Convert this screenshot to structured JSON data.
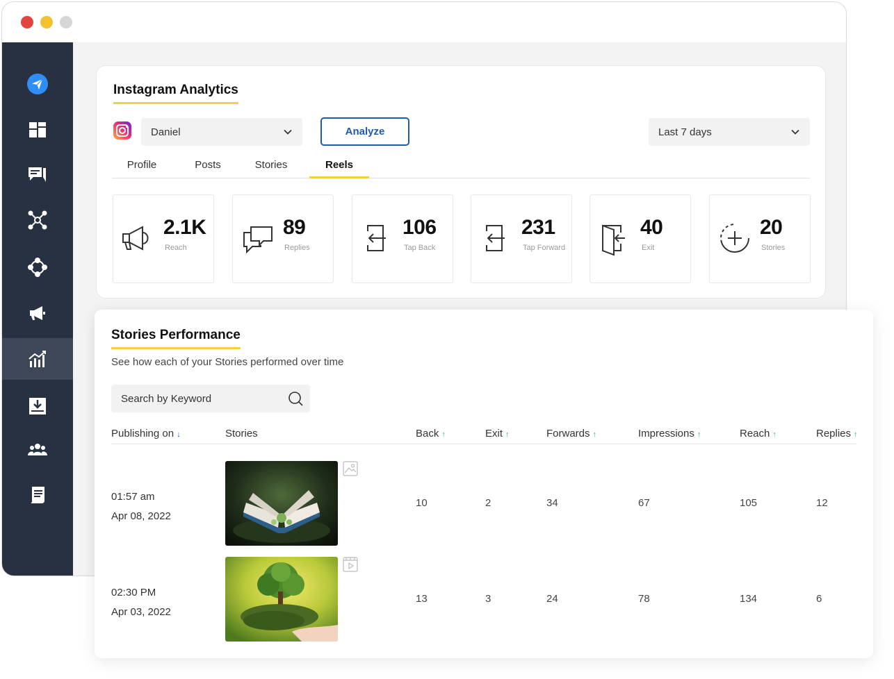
{
  "sidebar": {
    "items": [
      {
        "name": "send-icon",
        "active": false
      },
      {
        "name": "dashboard-icon",
        "active": false
      },
      {
        "name": "chat-icon",
        "active": false
      },
      {
        "name": "network-icon",
        "active": false
      },
      {
        "name": "hub-icon",
        "active": false
      },
      {
        "name": "megaphone-icon",
        "active": false
      },
      {
        "name": "analytics-icon",
        "active": true
      },
      {
        "name": "download-icon",
        "active": false
      },
      {
        "name": "users-icon",
        "active": false
      },
      {
        "name": "report-icon",
        "active": false
      }
    ]
  },
  "analytics": {
    "title": "Instagram Analytics",
    "account_select": "Daniel",
    "analyze_label": "Analyze",
    "range_select": "Last 7 days",
    "tabs": [
      {
        "label": "Profile",
        "active": false
      },
      {
        "label": "Posts",
        "active": false
      },
      {
        "label": "Stories",
        "active": false
      },
      {
        "label": "Reels",
        "active": true
      }
    ],
    "stats": [
      {
        "value": "2.1K",
        "label": "Reach",
        "icon": "megaphone-icon"
      },
      {
        "value": "89",
        "label": "Replies",
        "icon": "chat-bubbles-icon"
      },
      {
        "value": "106",
        "label": "Tap Back",
        "icon": "tap-back-icon"
      },
      {
        "value": "231",
        "label": "Tap Forward",
        "icon": "tap-forward-icon"
      },
      {
        "value": "40",
        "label": "Exit",
        "icon": "exit-door-icon"
      },
      {
        "value": "20",
        "label": "Stories",
        "icon": "add-circle-icon"
      }
    ]
  },
  "performance": {
    "title": "Stories Performance",
    "subtitle": "See how each of your Stories performed over time",
    "search_placeholder": "Search by Keyword",
    "columns": [
      {
        "label": "Publishing on",
        "sort": "↓"
      },
      {
        "label": "Stories",
        "sort": ""
      },
      {
        "label": "Back",
        "sort": "↑"
      },
      {
        "label": "Exit",
        "sort": "↑"
      },
      {
        "label": "Forwards",
        "sort": "↑"
      },
      {
        "label": "Impressions",
        "sort": "↑"
      },
      {
        "label": "Reach",
        "sort": "↑"
      },
      {
        "label": "Replies",
        "sort": "↑"
      }
    ],
    "rows": [
      {
        "time": "01:57 am",
        "date": "Apr 08, 2022",
        "media_type": "image-icon",
        "back": "10",
        "exit": "2",
        "forwards": "34",
        "impressions": "67",
        "reach": "105",
        "replies": "12"
      },
      {
        "time": "02:30 PM",
        "date": "Apr 03, 2022",
        "media_type": "video-icon",
        "back": "13",
        "exit": "3",
        "forwards": "24",
        "impressions": "78",
        "reach": "134",
        "replies": "6"
      }
    ]
  },
  "colors": {
    "sidebar": "#283142",
    "accent_yellow": "#f5cf3f",
    "accent_blue": "#1e5bb0",
    "sort_up_green": "#2bb673"
  }
}
